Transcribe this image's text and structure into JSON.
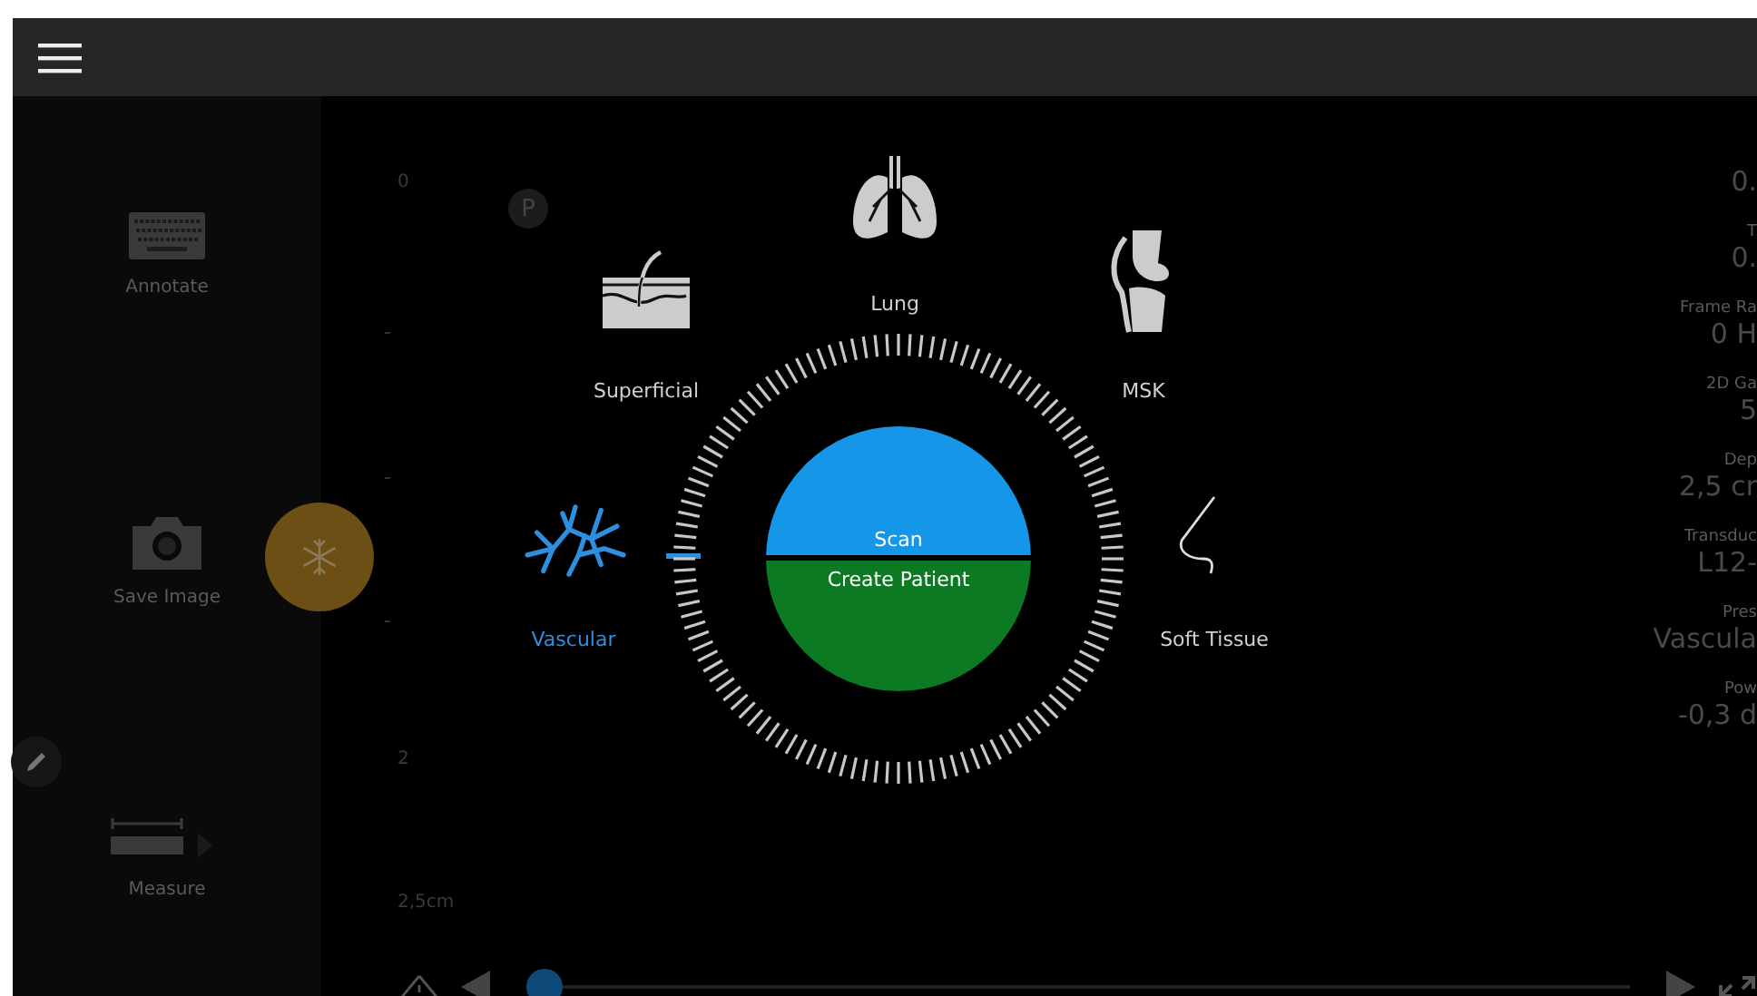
{
  "tools": [
    {
      "kind": "keyboard",
      "label": "Annotate"
    },
    {
      "kind": "camera",
      "label": "Save Image"
    },
    {
      "kind": "ruler",
      "label": "Measure"
    }
  ],
  "depth_scale": [
    "0",
    "2",
    "2,5cm"
  ],
  "preset_badge": "P",
  "modes": [
    {
      "kind": "lung",
      "label": "Lung",
      "selected": false
    },
    {
      "kind": "superficial",
      "label": "Superficial",
      "selected": false
    },
    {
      "kind": "msk",
      "label": "MSK",
      "selected": false
    },
    {
      "kind": "vascular",
      "label": "Vascular",
      "selected": true
    },
    {
      "kind": "soft_tissue",
      "label": "Soft Tissue",
      "selected": false
    }
  ],
  "dial": {
    "scan": "Scan",
    "create_patient": "Create Patient"
  },
  "parameters": [
    {
      "value": "0."
    },
    {
      "label": "T",
      "value": "0."
    },
    {
      "label": "Frame Ra",
      "value": "0 H"
    },
    {
      "label": "2D Ga",
      "value": "5"
    },
    {
      "label": "Dep",
      "value": "2,5 cr"
    },
    {
      "label": "Transduc",
      "value": "L12-"
    },
    {
      "label": "Pres",
      "value": "Vascula"
    },
    {
      "label": "Pow",
      "value": "-0,3 d"
    }
  ],
  "playback": {
    "level": 0
  }
}
